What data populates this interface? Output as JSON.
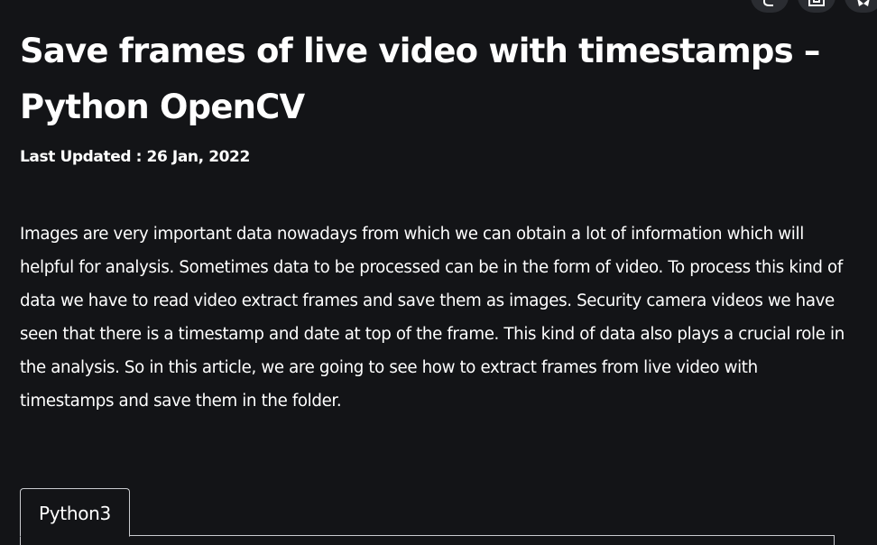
{
  "article": {
    "title": "Save frames of live video with timestamps – Python OpenCV",
    "updated_text": "Last Updated : 26 Jan, 2022",
    "intro": "Images are very important data nowadays from which we can obtain a lot of information which will helpful for analysis. Sometimes data to be processed can be in the form of video. To process this kind of data we have to read video extract frames and save them as images. Security camera videos we have seen that there is a timestamp and date at top of the frame. This kind of data also plays a crucial role in the analysis. So in this article, we are going to see how to extract frames from live video with timestamps and save them in the folder."
  },
  "code_tabs": [
    {
      "label": "Python3"
    }
  ],
  "actions": [
    {
      "icon": "share-icon"
    },
    {
      "icon": "bookmark-icon"
    },
    {
      "icon": "star-icon"
    }
  ],
  "colors": {
    "background": "#131417",
    "text": "#ffffff",
    "button_bg": "#2a2c31",
    "border": "#c9cbcf"
  }
}
